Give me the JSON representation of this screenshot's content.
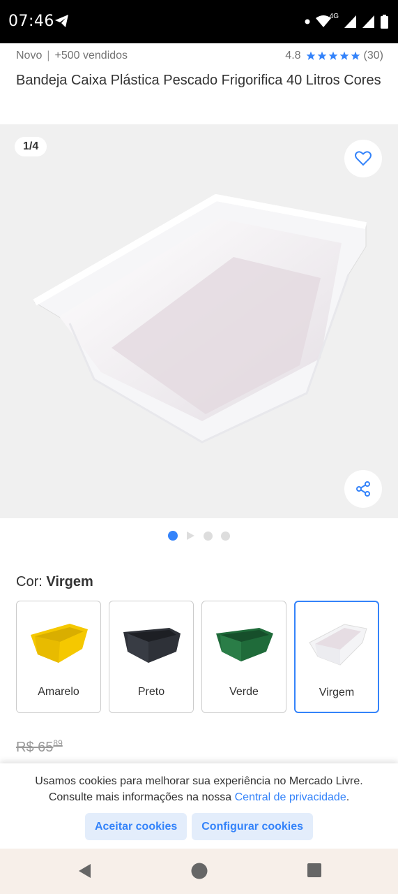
{
  "status_bar": {
    "time": "07:46",
    "network": "4G"
  },
  "product": {
    "condition": "Novo",
    "separator": "|",
    "sold": "+500 vendidos",
    "rating": "4.8",
    "reviews": "(30)",
    "title": "Bandeja Caixa Plástica Pescado Frigorifica 40 Litros Cores"
  },
  "gallery": {
    "counter": "1/4"
  },
  "color": {
    "label": "Cor:",
    "selected": "Virgem",
    "options": [
      {
        "label": "Amarelo",
        "color": "#f5c800"
      },
      {
        "label": "Preto",
        "color": "#2e3138"
      },
      {
        "label": "Verde",
        "color": "#1f6b3a"
      },
      {
        "label": "Virgem",
        "color": "#f4f4f6"
      }
    ]
  },
  "price": {
    "old_currency": "R$",
    "old_integer": "65",
    "old_cents": "89"
  },
  "cookie_banner": {
    "line1": "Usamos cookies para melhorar sua experiência no Mercado Livre.",
    "line2_prefix": "Consulte mais informações na nossa",
    "link": "Central de privacidade",
    "line2_suffix": ".",
    "accept": "Aceitar cookies",
    "configure": "Configurar cookies"
  },
  "colors": {
    "accent": "#3483fa",
    "text": "#333333",
    "muted": "#737373"
  }
}
